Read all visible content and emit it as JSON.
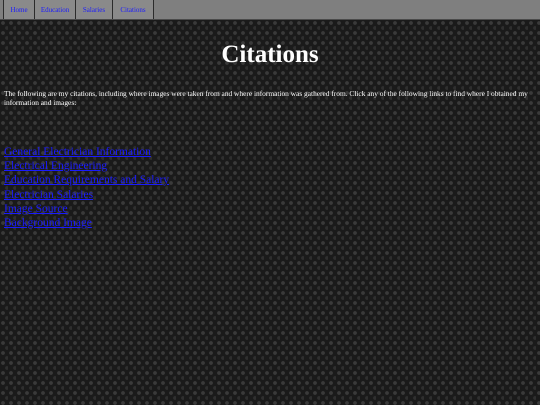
{
  "nav": {
    "items": [
      {
        "label": "Home"
      },
      {
        "label": "Education"
      },
      {
        "label": "Salaries"
      },
      {
        "label": "Citations"
      }
    ]
  },
  "page": {
    "title": "Citations",
    "intro": "The following are my citations, including where images were taken from and where information was gathered from. Click any of the following links to find where I obtained my information and images:"
  },
  "citations": [
    {
      "label": "General Electrician Information"
    },
    {
      "label": "Electrical Engineering"
    },
    {
      "label": "Education Requirements and Salary"
    },
    {
      "label": "Electrician Salaries"
    },
    {
      "label": "Image Source"
    },
    {
      "label": "Background Image"
    }
  ],
  "colors": {
    "link": "#1a1aff",
    "navbar": "#7f7f7f",
    "background": "#1a1a1a"
  }
}
